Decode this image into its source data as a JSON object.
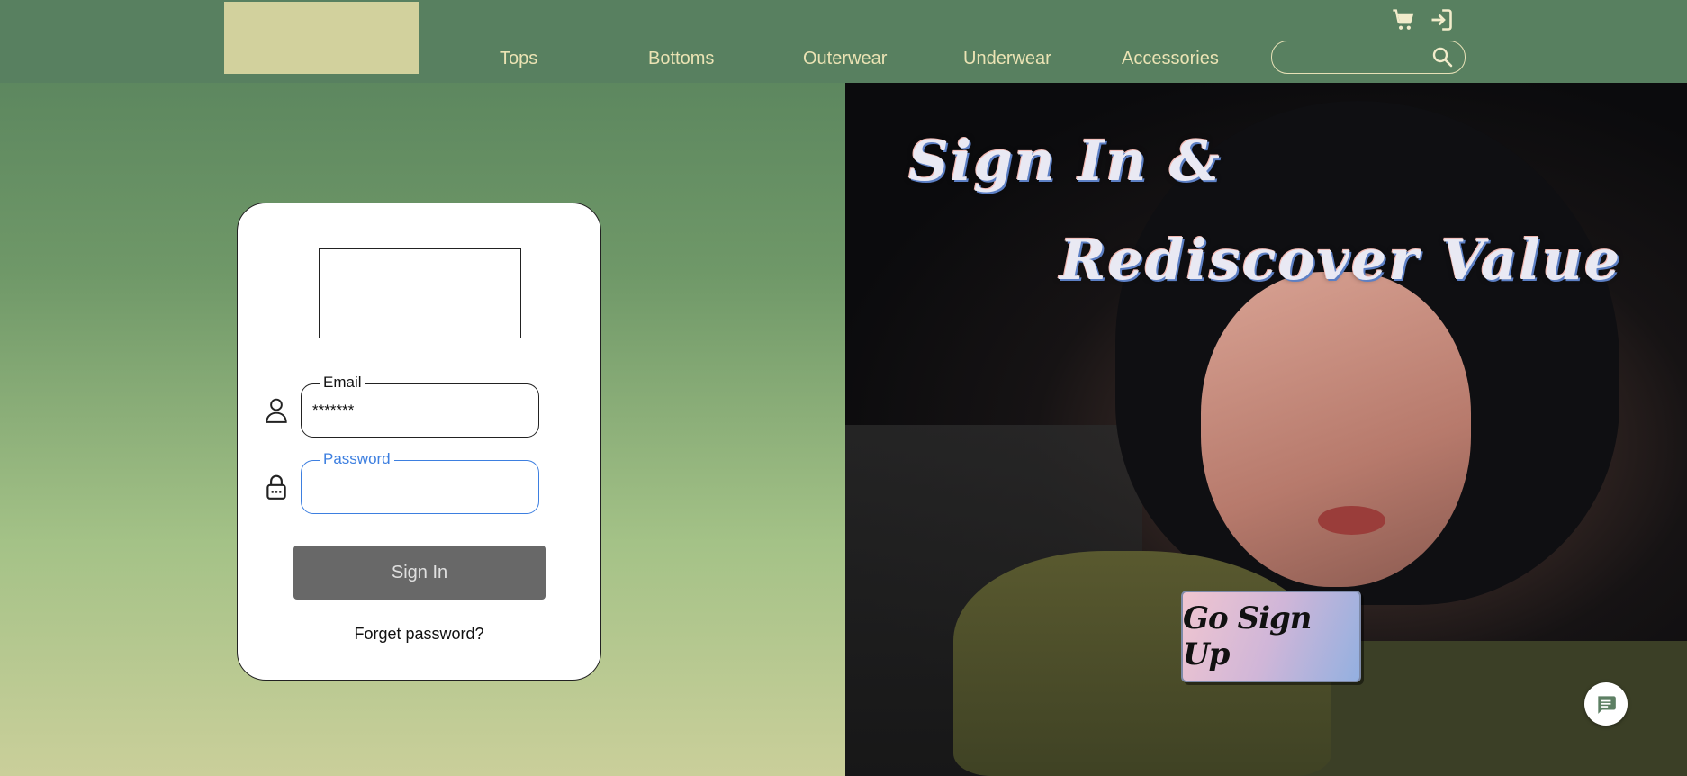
{
  "header": {
    "nav": [
      "Tops",
      "Bottoms",
      "Outerwear",
      "Underwear",
      "Accessories"
    ],
    "search_placeholder": "",
    "icons": [
      "cart-icon",
      "sign-in-icon",
      "search-icon"
    ]
  },
  "login": {
    "email_label": "Email",
    "email_value": "*******",
    "password_label": "Password",
    "password_value": "",
    "signin_label": "Sign In",
    "forget_label": "Forget password?",
    "icons": [
      "user-icon",
      "lock-icon"
    ]
  },
  "hero": {
    "title_line1": "Sign In &",
    "title_line2": "Rediscover Value",
    "signup_label": "Go Sign Up",
    "chat_icon": "chat-icon"
  },
  "colors": {
    "header_bg": "#588060",
    "logo_placeholder": "#d2d19d",
    "nav_text": "#ebe3b4",
    "focus_blue": "#3d7fe0",
    "signin_bg": "#686868"
  }
}
